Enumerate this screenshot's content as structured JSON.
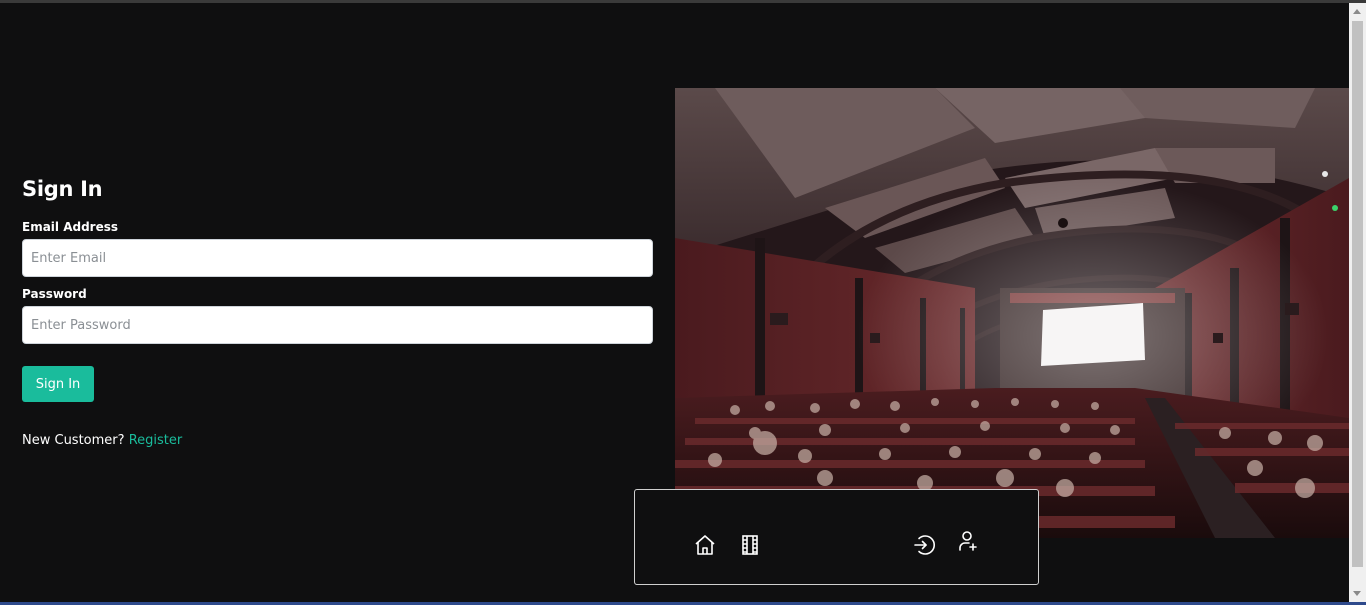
{
  "signin": {
    "title": "Sign In",
    "email_label": "Email Address",
    "email_placeholder": "Enter Email",
    "email_value": "",
    "password_label": "Password",
    "password_placeholder": "Enter Password",
    "password_value": "",
    "submit_label": "Sign In"
  },
  "footer_prompt": {
    "text": "New Customer?",
    "link_label": "Register"
  },
  "nav": {
    "icons": [
      "home-icon",
      "film-icon",
      "login-icon",
      "add-user-icon"
    ]
  },
  "colors": {
    "accent": "#1abc9c",
    "background": "#0f0f10",
    "text": "#ffffff"
  }
}
